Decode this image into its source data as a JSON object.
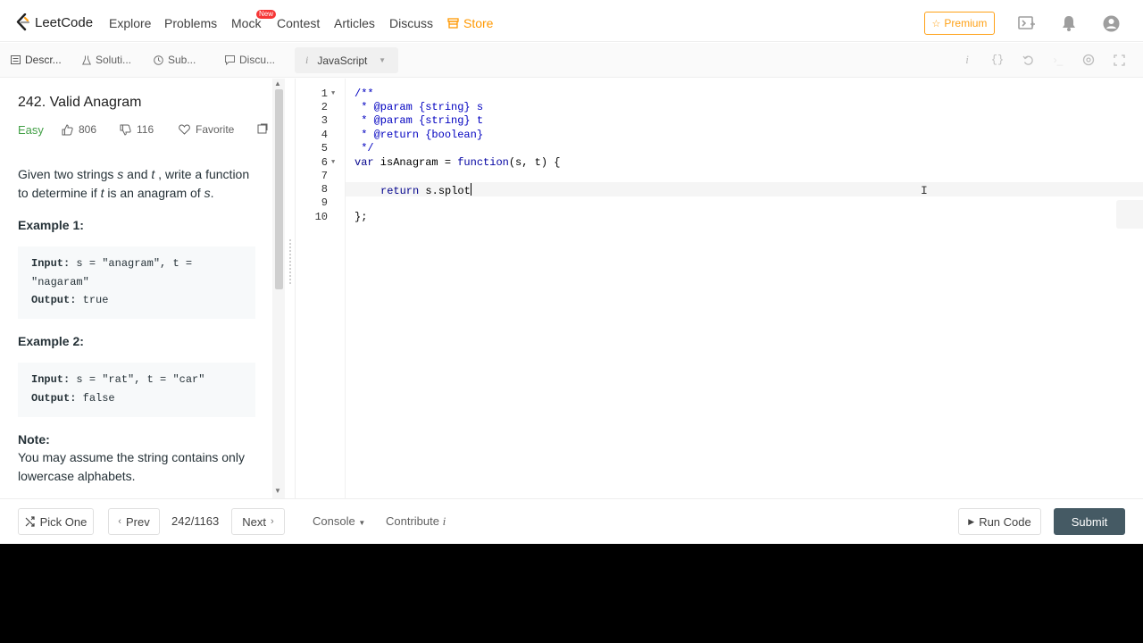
{
  "nav": {
    "logo_text": "LeetCode",
    "items": [
      "Explore",
      "Problems",
      "Mock",
      "Contest",
      "Articles",
      "Discuss"
    ],
    "badge": "New",
    "store": "Store",
    "premium": "Premium"
  },
  "tabs": {
    "items": [
      "Descr...",
      "Soluti...",
      "Sub...",
      "Discu..."
    ],
    "language": "JavaScript"
  },
  "problem": {
    "title": "242. Valid Anagram",
    "difficulty": "Easy",
    "likes": "806",
    "dislikes": "116",
    "favorite": "Favorite",
    "desc_1": "Given two strings ",
    "desc_s": "s",
    "desc_2": " and ",
    "desc_t": "t",
    "desc_3": " , write a function to determine if ",
    "desc_t2": "t",
    "desc_4": " is an anagram of ",
    "desc_s2": "s",
    "desc_5": ".",
    "example1_title": "Example 1:",
    "example1_input_label": "Input:",
    "example1_input": " s = \"anagram\", t = \"nagaram\"",
    "example1_output_label": "Output:",
    "example1_output": " true",
    "example2_title": "Example 2:",
    "example2_input_label": "Input:",
    "example2_input": " s = \"rat\", t = \"car\"",
    "example2_output_label": "Output:",
    "example2_output": " false",
    "note_title": "Note:",
    "note_text": "You may assume the string contains only lowercase alphabets."
  },
  "editor": {
    "line_numbers": [
      "1",
      "2",
      "3",
      "4",
      "5",
      "6",
      "7",
      "8",
      "9",
      "10"
    ],
    "lines": {
      "l1": "/**",
      "l2": " * @param {string} s",
      "l3": " * @param {string} t",
      "l4": " * @return {boolean}",
      "l5": " */",
      "l6_kw": "var",
      "l6_rest": " isAnagram = ",
      "l6_fn": "function",
      "l6_end": "(s, t) {",
      "l8_kw": "return",
      "l8_rest": " s.splot",
      "l10": "};"
    }
  },
  "bottom": {
    "pick_one": "Pick One",
    "prev": "Prev",
    "counter": "242/1163",
    "next": "Next",
    "console": "Console",
    "contribute": "Contribute",
    "run_code": "Run Code",
    "submit": "Submit"
  },
  "colors": {
    "premium": "#ffa116",
    "store": "#ff9800",
    "easy": "#43a047",
    "submit": "#455a64"
  }
}
